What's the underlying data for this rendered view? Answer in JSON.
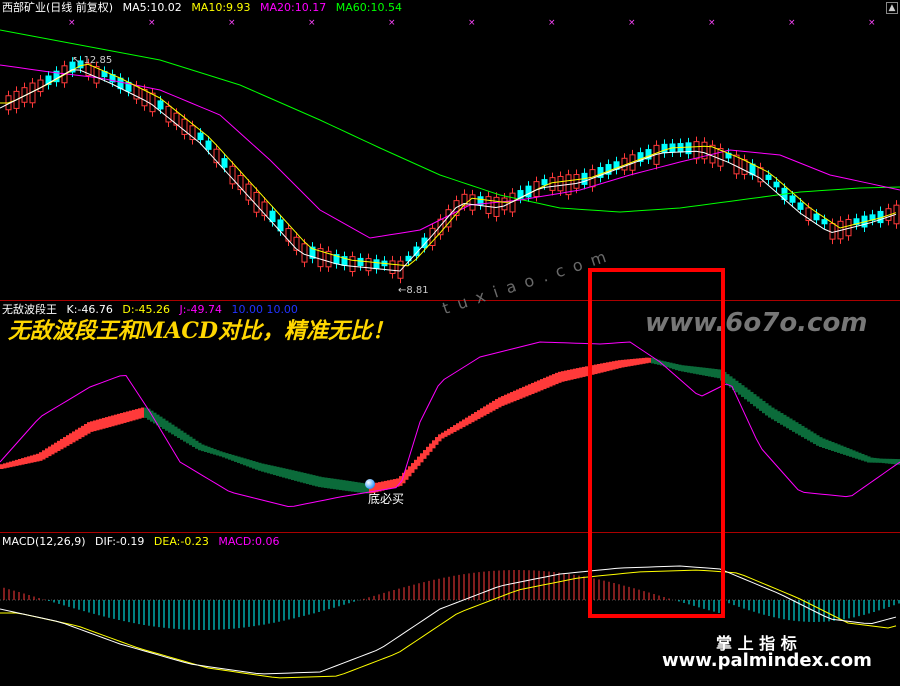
{
  "price_panel": {
    "stock_name": "西部矿业(日线 前复权)",
    "ma5": "MA5:10.02",
    "ma10": "MA10:9.93",
    "ma20": "MA20:10.17",
    "ma60": "MA60:10.54",
    "high_marker": "12.85",
    "low_marker": "8.81"
  },
  "wave_panel": {
    "indicator_name": "无敌波段王",
    "k": "K:-46.76",
    "d": "D:-45.26",
    "j": "J:-49.74",
    "hidden_label": "10.00 10.00",
    "signal_label": "底必买",
    "banner": "无敌波段王和MACD对比，精准无比！"
  },
  "macd_panel": {
    "name": "MACD(12,26,9)",
    "dif": "DIF:-0.19",
    "dea": "DEA:-0.23",
    "macd": "MACD:0.06"
  },
  "watermarks": {
    "top_site": "www.6o7o.com",
    "diagonal": "t u x i a o . c o m",
    "bottom_cn": "掌 上 指 标",
    "bottom_site": "www.palmindex.com"
  },
  "colors": {
    "up": "#ff3a3a",
    "down": "#00ffff",
    "ma5": "#ffffff",
    "ma10": "#ffff00",
    "ma20": "#ff00ff",
    "ma60": "#00ff00",
    "divider": "#aa0000",
    "highlight_box": "#ff0000"
  }
}
